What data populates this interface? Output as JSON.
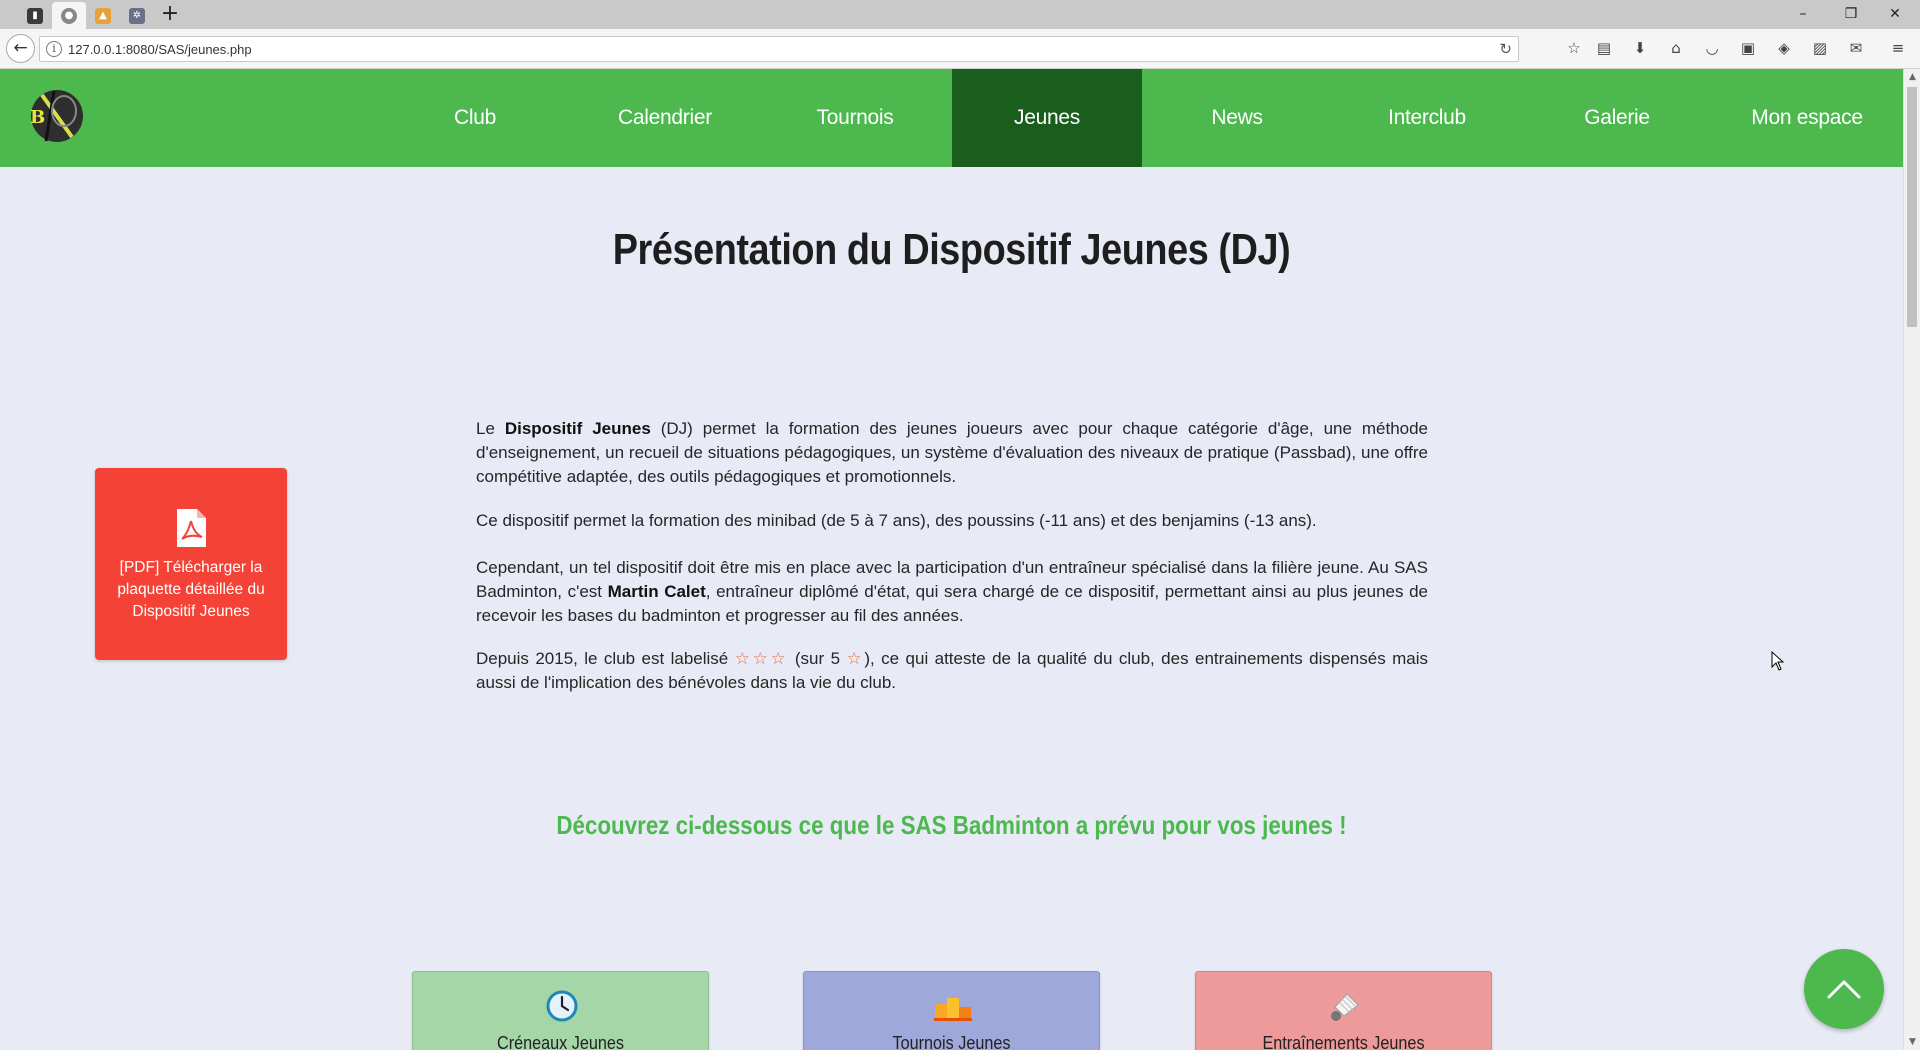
{
  "browser": {
    "tabs": [
      {
        "name": "tab-1",
        "glyph": "▮",
        "color": "#444444"
      },
      {
        "name": "tab-2",
        "glyph": "●",
        "color": "#555555"
      },
      {
        "name": "tab-3",
        "glyph": "▲",
        "color": "#e67e22"
      },
      {
        "name": "tab-4",
        "glyph": "✲",
        "color": "#6b6f8a"
      }
    ],
    "new_tab_label": "+",
    "window_controls": {
      "minimize": "–",
      "restore": "❐",
      "close": "✕"
    },
    "back_label": "←",
    "url": "127.0.0.1:8080/SAS/jeunes.php",
    "info_label": "i",
    "reload_label": "↻",
    "toolbar_icons": [
      "☆",
      "▤",
      "⬇",
      "⌂",
      "◡",
      "▣",
      "◈",
      "▨",
      "✉",
      "≡"
    ]
  },
  "site": {
    "menu": [
      {
        "label": "Club",
        "active": false
      },
      {
        "label": "Calendrier",
        "active": false
      },
      {
        "label": "Tournois",
        "active": false
      },
      {
        "label": "Jeunes",
        "active": true
      },
      {
        "label": "News",
        "active": false
      },
      {
        "label": "Interclub",
        "active": false
      },
      {
        "label": "Galerie",
        "active": false
      },
      {
        "label": "Mon espace",
        "active": false
      }
    ],
    "colors": {
      "nav": "#4cb84e",
      "nav_active": "#1a5e1e",
      "pdf_card": "#f44336",
      "accent": "#4cb84e",
      "star": "#f26c3a"
    }
  },
  "main": {
    "title": "Présentation du Dispositif Jeunes (DJ)",
    "pdf_card": {
      "icon": "pdf-icon",
      "label": "[PDF] Télécharger la plaquette détaillée du Dispositif Jeunes"
    },
    "p1": {
      "before": "Le ",
      "bold": "Dispositif Jeunes",
      "after": " (DJ) permet la formation des jeunes joueurs avec pour chaque catégorie d'âge, une méthode d'enseignement, un recueil de situations pédagogiques, un système d'évaluation des niveaux de pratique (Passbad), une offre compétitive adaptée, des outils pédagogiques et promotionnels."
    },
    "p2": "Ce dispositif permet la formation des minibad (de 5 à 7 ans), des poussins (-11 ans) et des benjamins (-13 ans).",
    "p3": {
      "before": "Cependant, un tel dispositif doit être mis en place avec la participation d'un entraîneur spécialisé dans la filière jeune. Au SAS Badminton, c'est ",
      "bold": "Martin Calet",
      "after": ", entraîneur diplômé d'état, qui sera chargé de ce dispositif, permettant ainsi au plus jeunes de recevoir les bases du badminton et progresser au fil des années."
    },
    "p4": {
      "before": "Depuis 2015, le club est labelisé ",
      "stars": "☆☆☆",
      "middle": " (sur 5 ",
      "star_single": "☆",
      "after": "), ce qui atteste de la qualité du club, des entrainements dispensés mais aussi de l'implication des bénévoles dans la vie du club."
    },
    "subtitle": "Découvrez ci-dessous ce que le SAS Badminton a prévu pour vos jeunes !",
    "cards": [
      {
        "label": "Créneaux Jeunes",
        "icon": "clock-icon",
        "color": "#a5d6a7"
      },
      {
        "label": "Tournois Jeunes",
        "icon": "podium-icon",
        "color": "#9fa8da"
      },
      {
        "label": "Entraînements Jeunes",
        "icon": "shuttlecock-icon",
        "color": "#ef9a9a"
      }
    ],
    "back_to_top_icon": "chevron-up-icon"
  }
}
